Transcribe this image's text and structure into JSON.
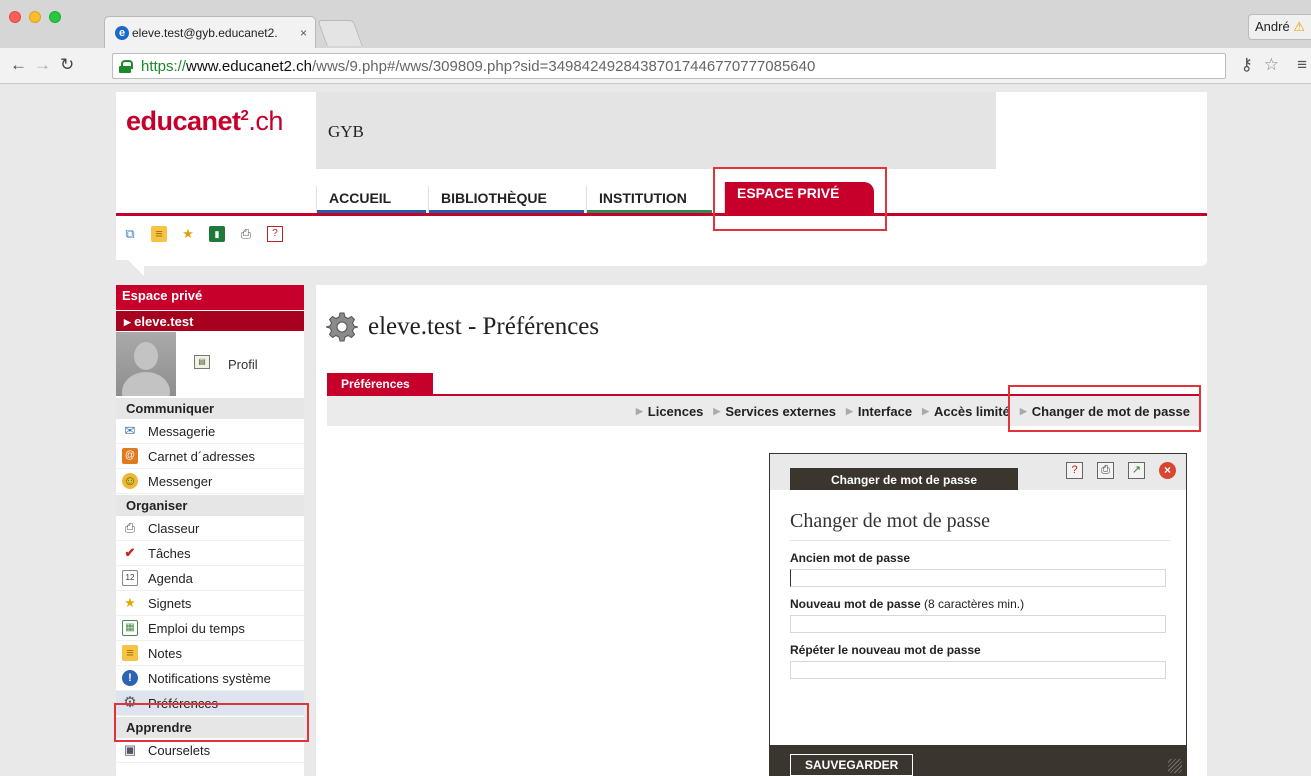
{
  "browser": {
    "tab_title": "eleve.test@gyb.educanet2.",
    "tab_close": "×",
    "user_name": "André",
    "url_scheme": "https://",
    "url_host": "www.educanet2.ch",
    "url_path": "/wws/9.php#/wws/309809.php?sid=34984249284387017446770777085640"
  },
  "header": {
    "logo_main": "educanet",
    "logo_sup": "2",
    "logo_suffix": ".ch",
    "school": "GYB",
    "nav_tabs": [
      {
        "label": "ACCUEIL",
        "color": "#1f5fa8"
      },
      {
        "label": "BIBLIOTHÈQUE",
        "color": "#1f5fa8"
      },
      {
        "label": "INSTITUTION",
        "color": "#2e8b57"
      },
      {
        "label": "ESPACE PRIVÉ",
        "color": "#c7002b"
      }
    ],
    "quick_icons": [
      "windows-icon",
      "notes-icon",
      "star-add-icon",
      "book-icon",
      "print-icon",
      "help-icon"
    ]
  },
  "sidebar": {
    "title": "Espace privé",
    "user": "eleve.test",
    "profile_label": "Profil",
    "sections": [
      {
        "title": "Communiquer",
        "items": [
          "Messagerie",
          "Carnet d´adresses",
          "Messenger"
        ]
      },
      {
        "title": "Organiser",
        "items": [
          "Classeur",
          "Tâches",
          "Agenda",
          "Signets",
          "Emploi du temps",
          "Notes",
          "Notifications système",
          "Préférences"
        ]
      },
      {
        "title": "Apprendre",
        "items": [
          "Courselets"
        ]
      }
    ]
  },
  "main": {
    "title": "eleve.test - Préférences",
    "tab": "Préférences",
    "subnav": [
      "Licences",
      "Services externes",
      "Interface",
      "Accès limité",
      "Changer de mot de passe"
    ]
  },
  "dialog": {
    "tab": "Changer de mot de passe",
    "title": "Changer de mot de passe",
    "fields": [
      {
        "label": "Ancien mot de passe",
        "hint": "",
        "value": ""
      },
      {
        "label": "Nouveau mot de passe",
        "hint": " (8 caractères min.)",
        "value": ""
      },
      {
        "label": "Répéter le nouveau mot de passe",
        "hint": "",
        "value": ""
      }
    ],
    "save_label": "SAUVEGARDER"
  },
  "colors": {
    "accent": "#c7002b",
    "dialog_dark": "#3b3530",
    "highlight": "#e3333a"
  }
}
